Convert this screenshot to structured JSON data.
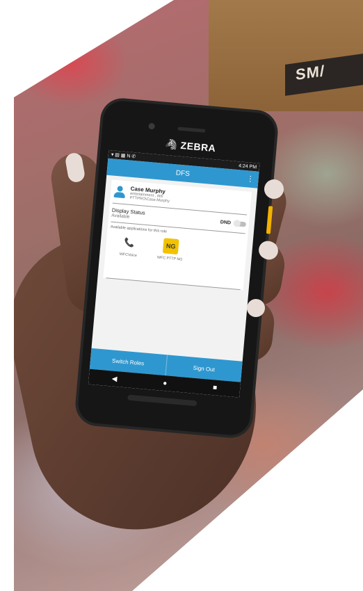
{
  "background": {
    "box_text": "SM/"
  },
  "device": {
    "brand": "ZEBRA",
    "status_bar": {
      "time": "4:24 PM"
    },
    "app_bar": {
      "title": "DFS",
      "menu_icon": "more-vert-icon"
    },
    "user": {
      "name": "Case Murphy",
      "line1": "entertainment , deli",
      "line2": "PTTPRO\\Case.Murphy"
    },
    "display_status": {
      "label": "Display Status",
      "value": "Available",
      "dnd_label": "DND",
      "dnd_on": false
    },
    "apps_label": "Available applications for this role",
    "apps": [
      {
        "name": "WFCVoice",
        "icon": "phone-wave-icon"
      },
      {
        "name": "WFC PTTP NG",
        "icon": "ptt-ng-icon"
      }
    ],
    "buttons": {
      "switch_roles": "Switch Roles",
      "sign_out": "Sign Out"
    },
    "colors": {
      "accent": "#2f97cf",
      "ptt": "#f2c200"
    }
  }
}
